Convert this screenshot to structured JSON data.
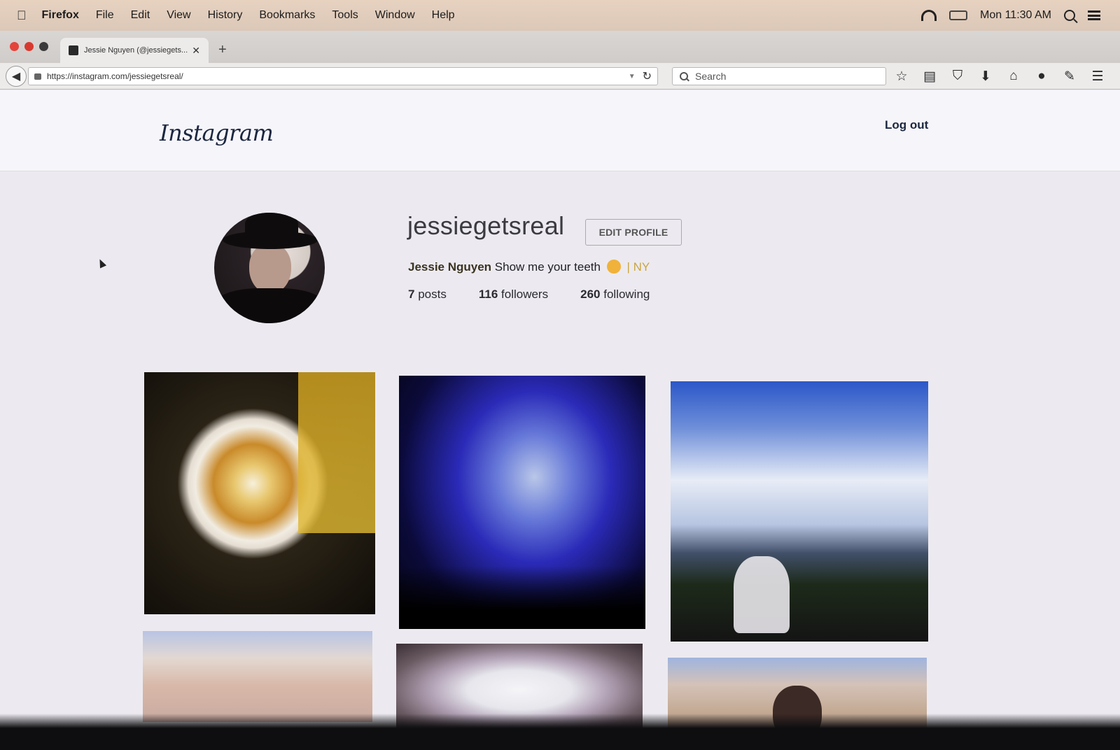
{
  "menubar": {
    "app": "Firefox",
    "items": [
      "File",
      "Edit",
      "View",
      "History",
      "Bookmarks",
      "Tools",
      "Window",
      "Help"
    ],
    "clock": "Mon 11:30 AM"
  },
  "browser": {
    "tab_title": "Jessie Nguyen (@jessiegets...",
    "url": "https://instagram.com/jessiegetsreal/",
    "search_placeholder": "Search",
    "toolbar_icons": [
      "bookmark-star-icon",
      "reading-list-icon",
      "pocket-icon",
      "download-icon",
      "home-icon",
      "chat-icon",
      "extension-icon",
      "menu-icon"
    ]
  },
  "instagram": {
    "logo": "Instagram",
    "logout": "Log out",
    "profile": {
      "username": "jessiegetsreal",
      "edit_button": "EDIT PROFILE",
      "full_name": "Jessie Nguyen",
      "bio": "Show me your teeth",
      "location": "| NY",
      "stats": {
        "posts_count": "7",
        "posts_label": "posts",
        "followers_count": "116",
        "followers_label": "followers",
        "following_count": "260",
        "following_label": "following"
      }
    },
    "photos": [
      "latte",
      "concert",
      "skyline",
      "hands",
      "cup",
      "beach"
    ]
  },
  "colors": {
    "ig_text": "#1b2740",
    "location": "#c9a640"
  }
}
